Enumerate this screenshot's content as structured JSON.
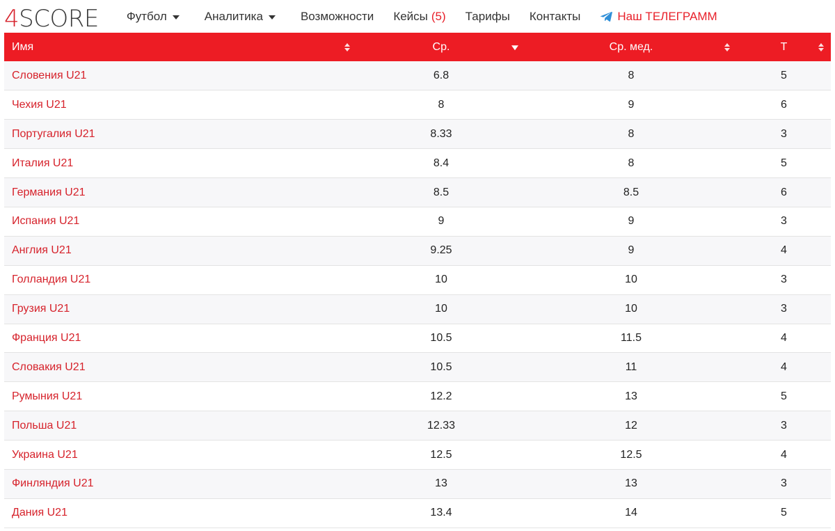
{
  "logo": {
    "digit": "4",
    "rest": "SCORE"
  },
  "nav": {
    "football": "Футбол",
    "analytics": "Аналитика",
    "features": "Возможности",
    "cases": "Кейсы",
    "cases_badge": "(5)",
    "tariffs": "Тарифы",
    "contacts": "Контакты",
    "telegram": "Наш ТЕЛЕГРАММ"
  },
  "table": {
    "headers": {
      "name": "Имя",
      "avg": "Ср.",
      "median": "Ср. мед.",
      "t": "Т"
    },
    "rows": [
      {
        "name": "Словения U21",
        "avg": "6.8",
        "median": "8",
        "t": "5"
      },
      {
        "name": "Чехия U21",
        "avg": "8",
        "median": "9",
        "t": "6"
      },
      {
        "name": "Португалия U21",
        "avg": "8.33",
        "median": "8",
        "t": "3"
      },
      {
        "name": "Италия U21",
        "avg": "8.4",
        "median": "8",
        "t": "5"
      },
      {
        "name": "Германия U21",
        "avg": "8.5",
        "median": "8.5",
        "t": "6"
      },
      {
        "name": "Испания U21",
        "avg": "9",
        "median": "9",
        "t": "3"
      },
      {
        "name": "Англия U21",
        "avg": "9.25",
        "median": "9",
        "t": "4"
      },
      {
        "name": "Голландия U21",
        "avg": "10",
        "median": "10",
        "t": "3"
      },
      {
        "name": "Грузия U21",
        "avg": "10",
        "median": "10",
        "t": "3"
      },
      {
        "name": "Франция U21",
        "avg": "10.5",
        "median": "11.5",
        "t": "4"
      },
      {
        "name": "Словакия U21",
        "avg": "10.5",
        "median": "11",
        "t": "4"
      },
      {
        "name": "Румыния U21",
        "avg": "12.2",
        "median": "13",
        "t": "5"
      },
      {
        "name": "Польша U21",
        "avg": "12.33",
        "median": "12",
        "t": "3"
      },
      {
        "name": "Украина U21",
        "avg": "12.5",
        "median": "12.5",
        "t": "4"
      },
      {
        "name": "Финляндия U21",
        "avg": "13",
        "median": "13",
        "t": "3"
      },
      {
        "name": "Дания U21",
        "avg": "13.4",
        "median": "14",
        "t": "5"
      }
    ]
  },
  "colors": {
    "brand_red": "#ed1c24",
    "link_red": "#d6222b",
    "telegram_blue": "#2f8fd8"
  },
  "icons": {
    "telegram": "paper-plane-icon",
    "dropdown": "caret-down-icon",
    "sort": "sort-icon",
    "sort_active": "sort-desc-icon"
  }
}
